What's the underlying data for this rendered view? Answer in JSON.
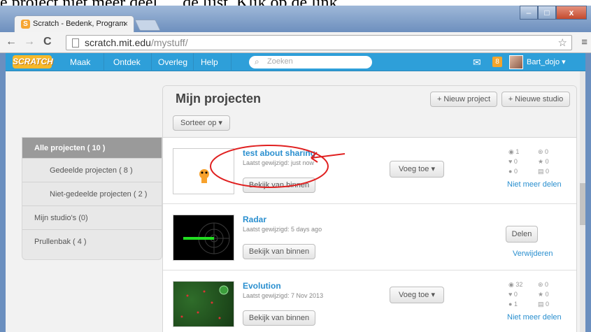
{
  "caption": "e project niet meer deel. ... de lijst. Klik op de link.",
  "browser": {
    "tab_title": "Scratch - Bedenk, Program",
    "tab_close": "×",
    "url_host": "scratch.mit.edu",
    "url_path": "/mystuff/",
    "back": "←",
    "forward": "→",
    "reload": "C",
    "star": "☆",
    "menu": "≡",
    "min": "–",
    "max": "□",
    "close": "x"
  },
  "scratch_nav": {
    "logo": "SCRATCH",
    "links": [
      "Maak",
      "Ontdek",
      "Overleg",
      "Help"
    ],
    "search_placeholder": "Zoeken",
    "mail_icon": "✉",
    "notif": "8",
    "username": "Bart_dojo ▾"
  },
  "sidebar": {
    "items": [
      "Alle projecten ( 10 )",
      "Gedeelde projecten ( 8 )",
      "Niet-gedeelde projecten ( 2 )",
      "Mijn studio's (0)",
      "Prullenbak ( 4 )"
    ]
  },
  "main": {
    "title": "Mijn projecten",
    "sort_label": "Sorteer op ▾",
    "new_project": "+ Nieuw project",
    "new_studio": "+ Nieuwe studio"
  },
  "projects": [
    {
      "title": "test about sharing",
      "modified": "Laatst gewijzigd: just now",
      "inside": "Bekijk van binnen",
      "add_to": "Voeg toe ▾",
      "stats": [
        "1",
        "0",
        "0",
        "0",
        "0",
        "0"
      ],
      "link": "Niet meer delen"
    },
    {
      "title": "Radar",
      "modified": "Laatst gewijzigd: 5 days ago",
      "inside": "Bekijk van binnen",
      "share": "Delen",
      "link": "Verwijderen"
    },
    {
      "title": "Evolution",
      "modified": "Laatst gewijzigd: 7 Nov 2013",
      "inside": "Bekijk van binnen",
      "add_to": "Voeg toe ▾",
      "stats": [
        "32",
        "0",
        "0",
        "0",
        "1",
        "0"
      ],
      "link": "Niet meer delen"
    }
  ],
  "colors": {
    "scratch_blue": "#2e9fd9",
    "link_blue": "#2a8fcf",
    "annotation_red": "#e02020"
  }
}
